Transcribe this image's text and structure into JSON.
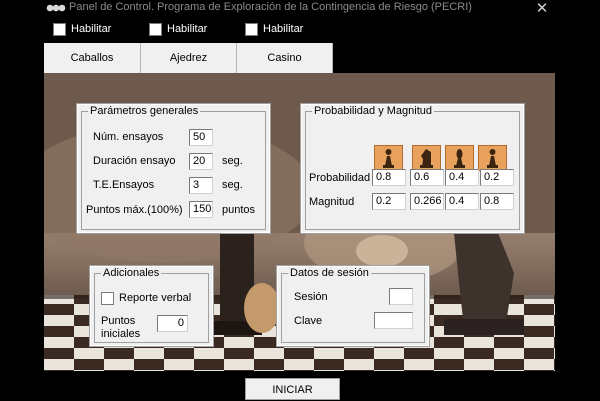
{
  "window": {
    "title": "Panel de Control. Programa de Exploración de la Contingencia de Riesgo (PECRI)",
    "close_glyph": "✕"
  },
  "habilitar": [
    {
      "label": "Habilitar",
      "checked": false
    },
    {
      "label": "Habilitar",
      "checked": false
    },
    {
      "label": "Habilitar",
      "checked": false
    }
  ],
  "tabs": [
    {
      "label": "Caballos"
    },
    {
      "label": "Ajedrez"
    },
    {
      "label": "Casino"
    }
  ],
  "parametros": {
    "title": "Parámetros generales",
    "num_ensayos": {
      "label": "Núm. ensayos",
      "value": "50"
    },
    "duracion": {
      "label": "Duración ensayo",
      "value": "20",
      "unit": "seg."
    },
    "te": {
      "label": "T.E.Ensayos",
      "value": "3",
      "unit": "seg."
    },
    "puntos_max": {
      "label": "Puntos máx.(100%)",
      "value": "150",
      "unit": "puntos"
    }
  },
  "probabilidad": {
    "title": "Probabilidad y Magnitud",
    "pieces": [
      "chess-pawn-icon",
      "chess-knight-icon",
      "chess-bishop-icon",
      "chess-pawn-icon"
    ],
    "prob_label": "Probabilidad",
    "prob_values": [
      "0.8",
      "0.6",
      "0.4",
      "0.2"
    ],
    "mag_label": "Magnitud",
    "mag_values": [
      "0.2",
      "0.266",
      "0.4",
      "0.8"
    ]
  },
  "adicionales": {
    "title": "Adicionales",
    "reporte_label": "Reporte verbal",
    "reporte_checked": false,
    "puntos_label_1": "Puntos",
    "puntos_label_2": "iniciales",
    "puntos_value": "0"
  },
  "sesion": {
    "title": "Datos de sesión",
    "sesion_label": "Sesión",
    "sesion_value": "",
    "clave_label": "Clave",
    "clave_value": ""
  },
  "iniciar_label": "INICIAR",
  "colors": {
    "background": "#000000",
    "panel": "#f0f0f0",
    "piece_bg": "#e8a25e",
    "title_text": "#8a8a8a"
  }
}
